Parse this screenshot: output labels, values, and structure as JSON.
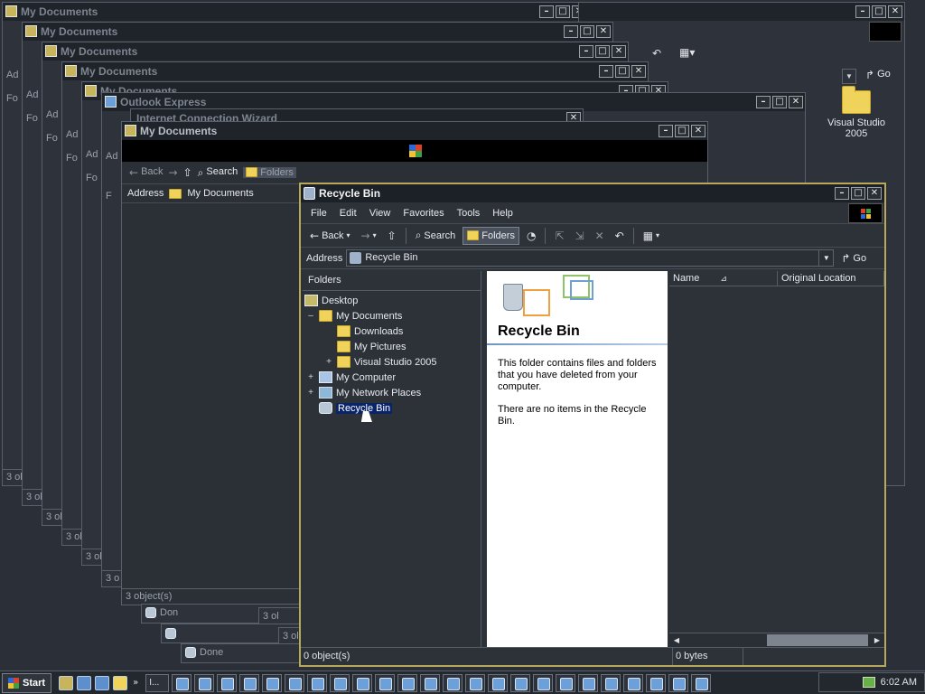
{
  "background_windows": [
    {
      "title": "My Documents",
      "status": "3 obj",
      "peek": [
        "Ad",
        "Fo"
      ]
    },
    {
      "title": "My Documents",
      "status": "3 ob",
      "peek": [
        "Ad",
        "Fo"
      ]
    },
    {
      "title": "My Documents",
      "status": "3 ol",
      "peek": [
        "Ad",
        "Fo"
      ]
    },
    {
      "title": "My Documents",
      "status": "3 ol",
      "peek": [
        "Ad",
        "Fo"
      ]
    },
    {
      "title": "My Documents",
      "status": "3 ol",
      "peek": [
        "Ad",
        "Fo"
      ]
    },
    {
      "title": "Outlook Express",
      "status": "3 o",
      "peek": [
        "Ad",
        "F"
      ]
    },
    {
      "title": "Internet Connection Wizard",
      "status": "",
      "peek": []
    },
    {
      "title": "My Documents",
      "status": "3 object(s)",
      "peek": []
    }
  ],
  "mydocs_front": {
    "title": "My Documents",
    "back_label": "Back",
    "search_label": "Search",
    "folders_label": "Folders",
    "address_label": "Address",
    "address_value": "My Documents",
    "status": "3 object(s)"
  },
  "lower_fragments": {
    "done1": "Don",
    "done2": "Done",
    "s1": "3 ol",
    "s2": "3 ol"
  },
  "desktop": {
    "icon_label": "Visual Studio 2005",
    "go_label": "Go"
  },
  "recycle_bin": {
    "title": "Recycle Bin",
    "menu": [
      "File",
      "Edit",
      "View",
      "Favorites",
      "Tools",
      "Help"
    ],
    "toolbar": {
      "back": "Back",
      "search": "Search",
      "folders": "Folders"
    },
    "address": {
      "label": "Address",
      "value": "Recycle Bin",
      "go": "Go"
    },
    "folders_header": "Folders",
    "tree": [
      {
        "label": "Desktop",
        "icon": "desktop-icon"
      },
      {
        "label": "My Documents",
        "icon": "folder-icon"
      },
      {
        "label": "Downloads",
        "icon": "folder-icon"
      },
      {
        "label": "My Pictures",
        "icon": "folder-icon"
      },
      {
        "label": "Visual Studio 2005",
        "icon": "folder-icon"
      },
      {
        "label": "My Computer",
        "icon": "computer-icon"
      },
      {
        "label": "My Network Places",
        "icon": "network-icon"
      },
      {
        "label": "Recycle Bin",
        "icon": "recycle-bin-icon",
        "selected": true
      }
    ],
    "info": {
      "heading": "Recycle Bin",
      "para1": "This folder contains files and folders that you have deleted from your computer.",
      "para2": "There are no items in the Recycle Bin."
    },
    "columns": [
      "Name",
      "Original Location"
    ],
    "status": {
      "objects": "0 object(s)",
      "size": "0 bytes"
    }
  },
  "taskbar": {
    "start": "Start",
    "clock": "6:02 AM",
    "tasks_text": "I..."
  },
  "colors": {
    "selected": "#0a246a",
    "title_active": "#1c2027",
    "frame_accent": "#b7a85c"
  }
}
